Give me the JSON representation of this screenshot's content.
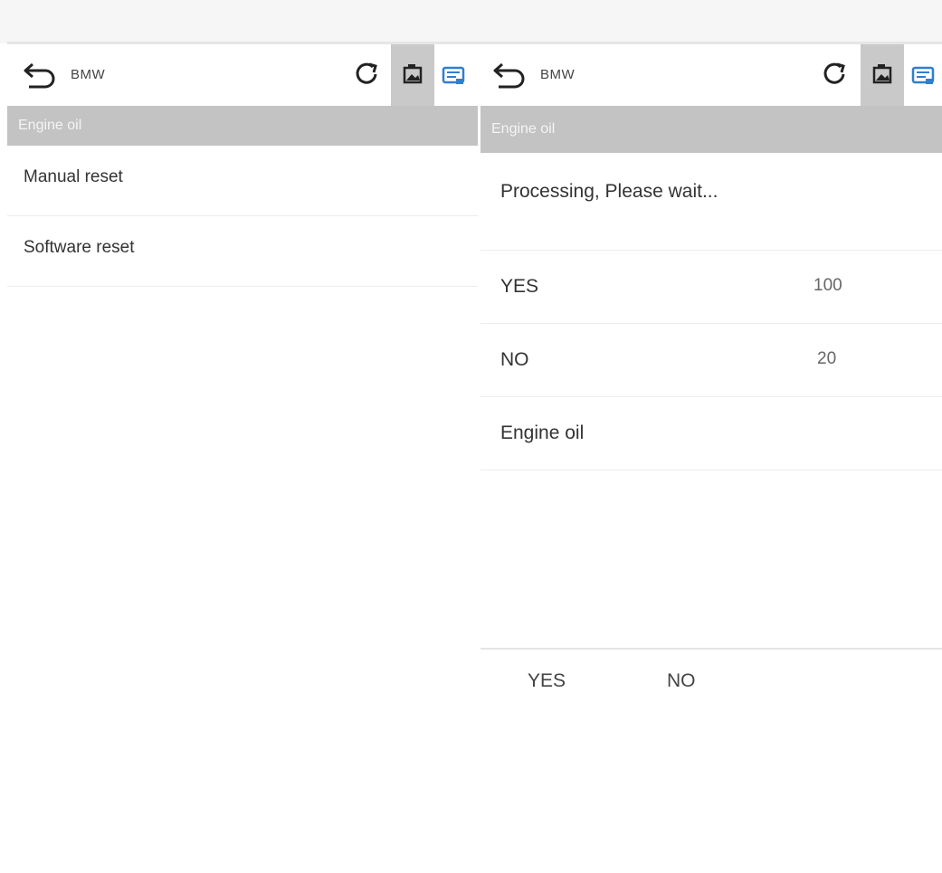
{
  "left": {
    "toolbar": {
      "brand": "BMW"
    },
    "section_title": "Engine oil",
    "items": [
      {
        "label": "Manual reset"
      },
      {
        "label": "Software reset"
      }
    ]
  },
  "right": {
    "toolbar": {
      "brand": "BMW"
    },
    "section_title": "Engine oil",
    "status": "Processing, Please wait...",
    "rows": [
      {
        "label": "YES",
        "value": "100"
      },
      {
        "label": "NO",
        "value": "20"
      },
      {
        "label": "Engine oil",
        "value": ""
      }
    ],
    "footer": {
      "yes_label": "YES",
      "no_label": "NO"
    }
  },
  "icons": {
    "back": "back-arrow-icon",
    "refresh": "refresh-icon",
    "screenshot": "image-icon",
    "print": "print-icon"
  },
  "colors": {
    "section_bar": "#c3c3c3",
    "selected_tool": "#c9c9c9",
    "accent_blue": "#2f7fd0"
  }
}
